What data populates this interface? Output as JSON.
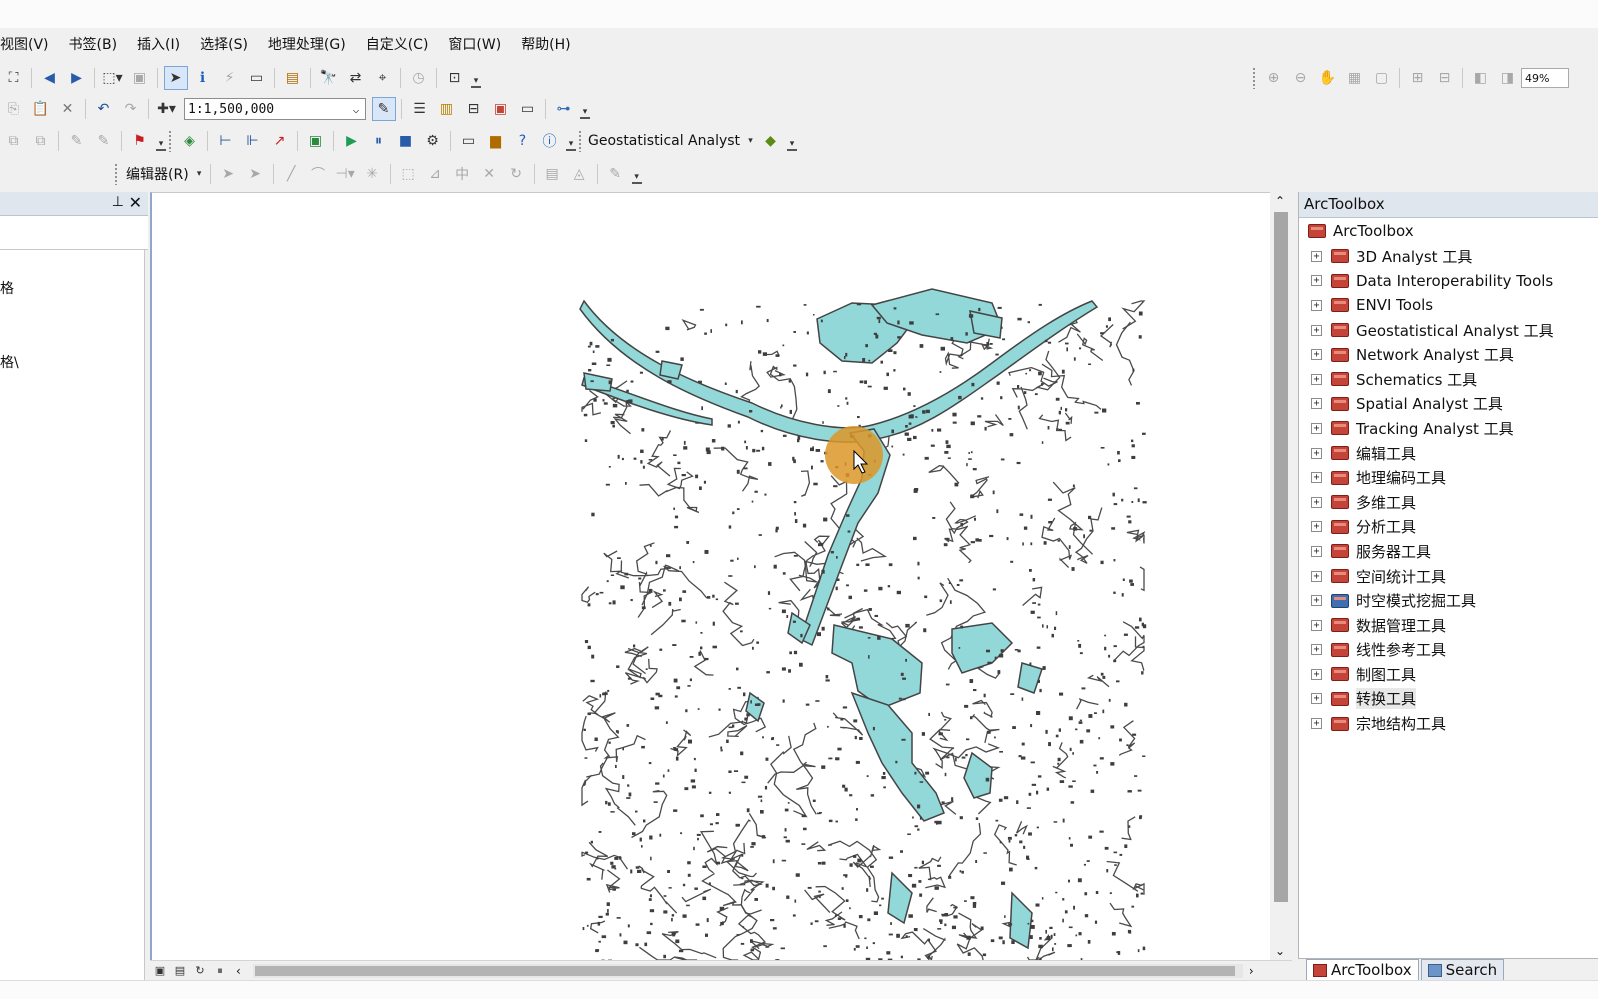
{
  "menubar": {
    "items": [
      "视图(V)",
      "书签(B)",
      "插入(I)",
      "选择(S)",
      "地理处理(G)",
      "自定义(C)",
      "窗口(W)",
      "帮助(H)"
    ]
  },
  "toolbar": {
    "scale_value": "1:1,500,000",
    "geostatistical_label": "Geostatistical Analyst",
    "editor_label": "编辑器(R)",
    "zoom_value": "49%"
  },
  "toc": {
    "row1": "格",
    "row2": "格\\"
  },
  "toolbox": {
    "title": "ArcToolbox",
    "root": "ArcToolbox",
    "items": [
      "3D Analyst 工具",
      "Data Interoperability Tools",
      "ENVI Tools",
      "Geostatistical Analyst 工具",
      "Network Analyst 工具",
      "Schematics 工具",
      "Spatial Analyst 工具",
      "Tracking Analyst 工具",
      "编辑工具",
      "地理编码工具",
      "多维工具",
      "分析工具",
      "服务器工具",
      "空间统计工具",
      "时空模式挖掘工具",
      "数据管理工具",
      "线性参考工具",
      "制图工具",
      "转换工具",
      "宗地结构工具"
    ],
    "tabs": [
      "ArcToolbox",
      "Search"
    ]
  },
  "colors": {
    "water_fill": "#93d8d8",
    "water_outline": "#444444",
    "cursor_highlight": "#dc9628",
    "toolbox_icon": "#c4443a"
  }
}
